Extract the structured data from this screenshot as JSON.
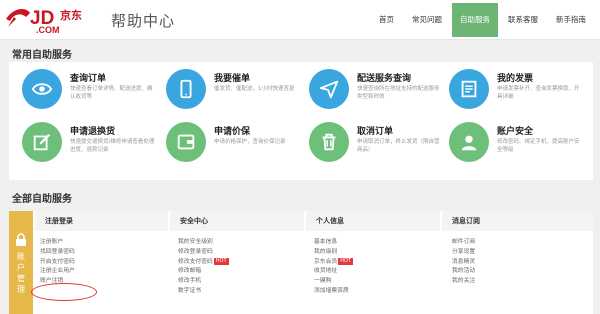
{
  "header": {
    "logo_main": "JD",
    "logo_dot_com": ".COM",
    "logo_cn": "京东",
    "help_title": "帮助中心",
    "nav": [
      "首页",
      "常见问题",
      "自助服务",
      "联系客服",
      "新手指南"
    ]
  },
  "common": {
    "title": "常用自助服务",
    "items": [
      {
        "name": "查询订单",
        "desc": "快速查看订单详情、配送进度、确认收货等",
        "icon": "eye-icon",
        "color": "#3aa6e0"
      },
      {
        "name": "我要催单",
        "desc": "催发货、催配送，1小时快速答复",
        "icon": "phone-icon",
        "color": "#3aa6e0"
      },
      {
        "name": "配送服务查询",
        "desc": "快速查询所在地址支持的配送服务类型和时效",
        "icon": "paper-plane-icon",
        "color": "#3aa6e0"
      },
      {
        "name": "我的发票",
        "desc": "申请发票补开、查询发票换取、开具详细",
        "icon": "invoice-icon",
        "color": "#3aa6e0"
      },
      {
        "name": "申请退换货",
        "desc": "快速提交退换货/维修申请查看处理进度、退款记录",
        "icon": "edit-icon",
        "color": "#6dbf7a"
      },
      {
        "name": "申请价保",
        "desc": "申请价格保护，查询价保记录",
        "icon": "wallet-icon",
        "color": "#6dbf7a"
      },
      {
        "name": "取消订单",
        "desc": "申请取消订单，终止发货（限自营商品）",
        "icon": "trash-icon",
        "color": "#6dbf7a"
      },
      {
        "name": "账户安全",
        "desc": "修改密码、绑定手机、提高账户安全等级",
        "icon": "user-icon",
        "color": "#6dbf7a"
      }
    ]
  },
  "all": {
    "title": "全部自助服务",
    "side_label": "账户管理",
    "columns": [
      {
        "title": "注册登录",
        "links": [
          {
            "text": "注册账户"
          },
          {
            "text": "找回登录密码"
          },
          {
            "text": "开启支付密码"
          },
          {
            "text": "注册企业用户"
          },
          {
            "text": "账户注销"
          }
        ]
      },
      {
        "title": "安全中心",
        "links": [
          {
            "text": "我的安全级别"
          },
          {
            "text": "修改登录密码"
          },
          {
            "text": "修改支付密码",
            "hot": "HOT"
          },
          {
            "text": "修改邮箱"
          },
          {
            "text": "修改手机"
          },
          {
            "text": "数字证书"
          }
        ]
      },
      {
        "title": "个人信息",
        "links": [
          {
            "text": "基本信息"
          },
          {
            "text": "我的级别"
          },
          {
            "text": "京东会员",
            "hot": "HOT"
          },
          {
            "text": "收货地址"
          },
          {
            "text": "一键购"
          },
          {
            "text": "添加增票资质"
          }
        ]
      },
      {
        "title": "消息订阅",
        "links": [
          {
            "text": "邮件订阅"
          },
          {
            "text": "分享设置"
          },
          {
            "text": "消息精灵"
          },
          {
            "text": "我的活动"
          },
          {
            "text": "我的关注"
          }
        ]
      }
    ]
  }
}
